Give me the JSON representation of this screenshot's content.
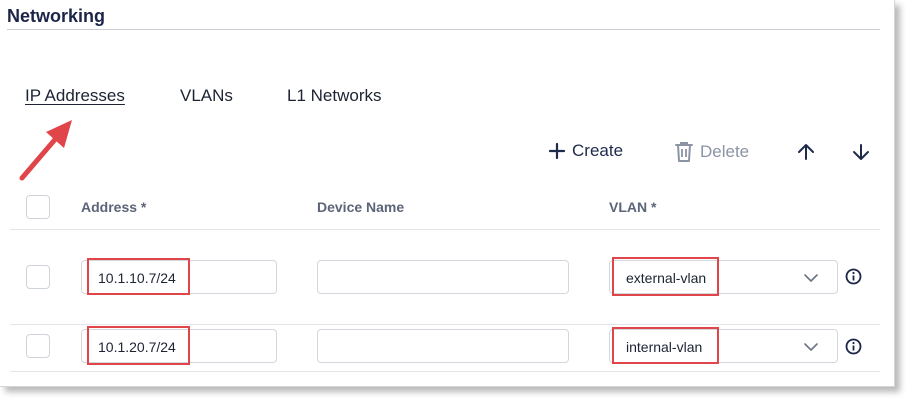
{
  "section": {
    "title": "Networking"
  },
  "tabs": [
    {
      "label": "IP Addresses",
      "active": true
    },
    {
      "label": "VLANs",
      "active": false
    },
    {
      "label": "L1 Networks",
      "active": false
    }
  ],
  "toolbar": {
    "create_label": "Create",
    "delete_label": "Delete",
    "icons": [
      "plus-icon",
      "trash-icon",
      "arrow-up-icon",
      "arrow-down-icon"
    ]
  },
  "table": {
    "columns": [
      "Address *",
      "Device Name",
      "VLAN *"
    ],
    "rows": [
      {
        "address": "10.1.10.7/24",
        "device_name": "",
        "vlan": "external-vlan"
      },
      {
        "address": "10.1.20.7/24",
        "device_name": "",
        "vlan": "internal-vlan"
      }
    ]
  },
  "colors": {
    "title": "#1c2448",
    "annotation_red": "#e0454a",
    "muted_text": "#5b6478",
    "disabled": "#8b93a4"
  }
}
